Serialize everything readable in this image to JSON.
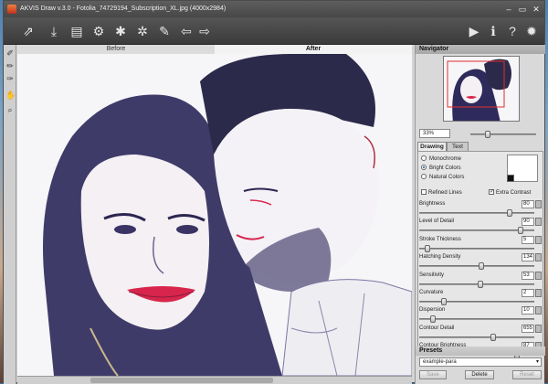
{
  "window": {
    "title": "AKVIS Draw v.3.0 - Fotolia_74729194_Subscription_XL.jpg (4000x2984)"
  },
  "toolbar": {
    "icons": [
      "open-icon",
      "save-icon",
      "print-icon",
      "share-icon",
      "batch-icon",
      "plugin-icon",
      "paint-icon",
      "undo-icon",
      "redo-icon",
      "run-icon",
      "info-icon",
      "help-icon",
      "settings-icon"
    ]
  },
  "left_tools": [
    "brush-icon",
    "eraser-icon",
    "history-brush-icon",
    "hand-icon",
    "zoom-icon"
  ],
  "view_tabs": {
    "before": "Before",
    "after": "After"
  },
  "navigator": {
    "title": "Navigator",
    "zoom": "33%"
  },
  "settings_tabs": {
    "drawing": "Drawing",
    "text": "Text"
  },
  "style_options": [
    {
      "label": "Monochrome",
      "selected": false
    },
    {
      "label": "Bright Colors",
      "selected": true
    },
    {
      "label": "Natural Colors",
      "selected": false
    }
  ],
  "checks": {
    "refined_lines": {
      "label": "Refined Lines",
      "checked": false
    },
    "extra_contrast": {
      "label": "Extra Contrast",
      "checked": true
    }
  },
  "params": [
    {
      "label": "Brightness",
      "value": "80"
    },
    {
      "label": "Level of Detail",
      "value": "90"
    },
    {
      "label": "Stroke Thickness",
      "value": "5"
    },
    {
      "label": "Hatching Density",
      "value": "134"
    },
    {
      "label": "Sensitivity",
      "value": "53"
    },
    {
      "label": "Curvature",
      "value": "2"
    },
    {
      "label": "Dispersion",
      "value": "10"
    },
    {
      "label": "Contour Detail",
      "value": "655"
    },
    {
      "label": "Contour Brightness",
      "value": "87"
    }
  ],
  "param_levels": [
    0.8,
    0.9,
    0.05,
    0.54,
    0.53,
    0.2,
    0.1,
    0.65,
    0.87
  ],
  "presets": {
    "title": "Presets",
    "selected": "example-para",
    "save": "Save",
    "delete": "Delete",
    "reset": "Reset"
  }
}
